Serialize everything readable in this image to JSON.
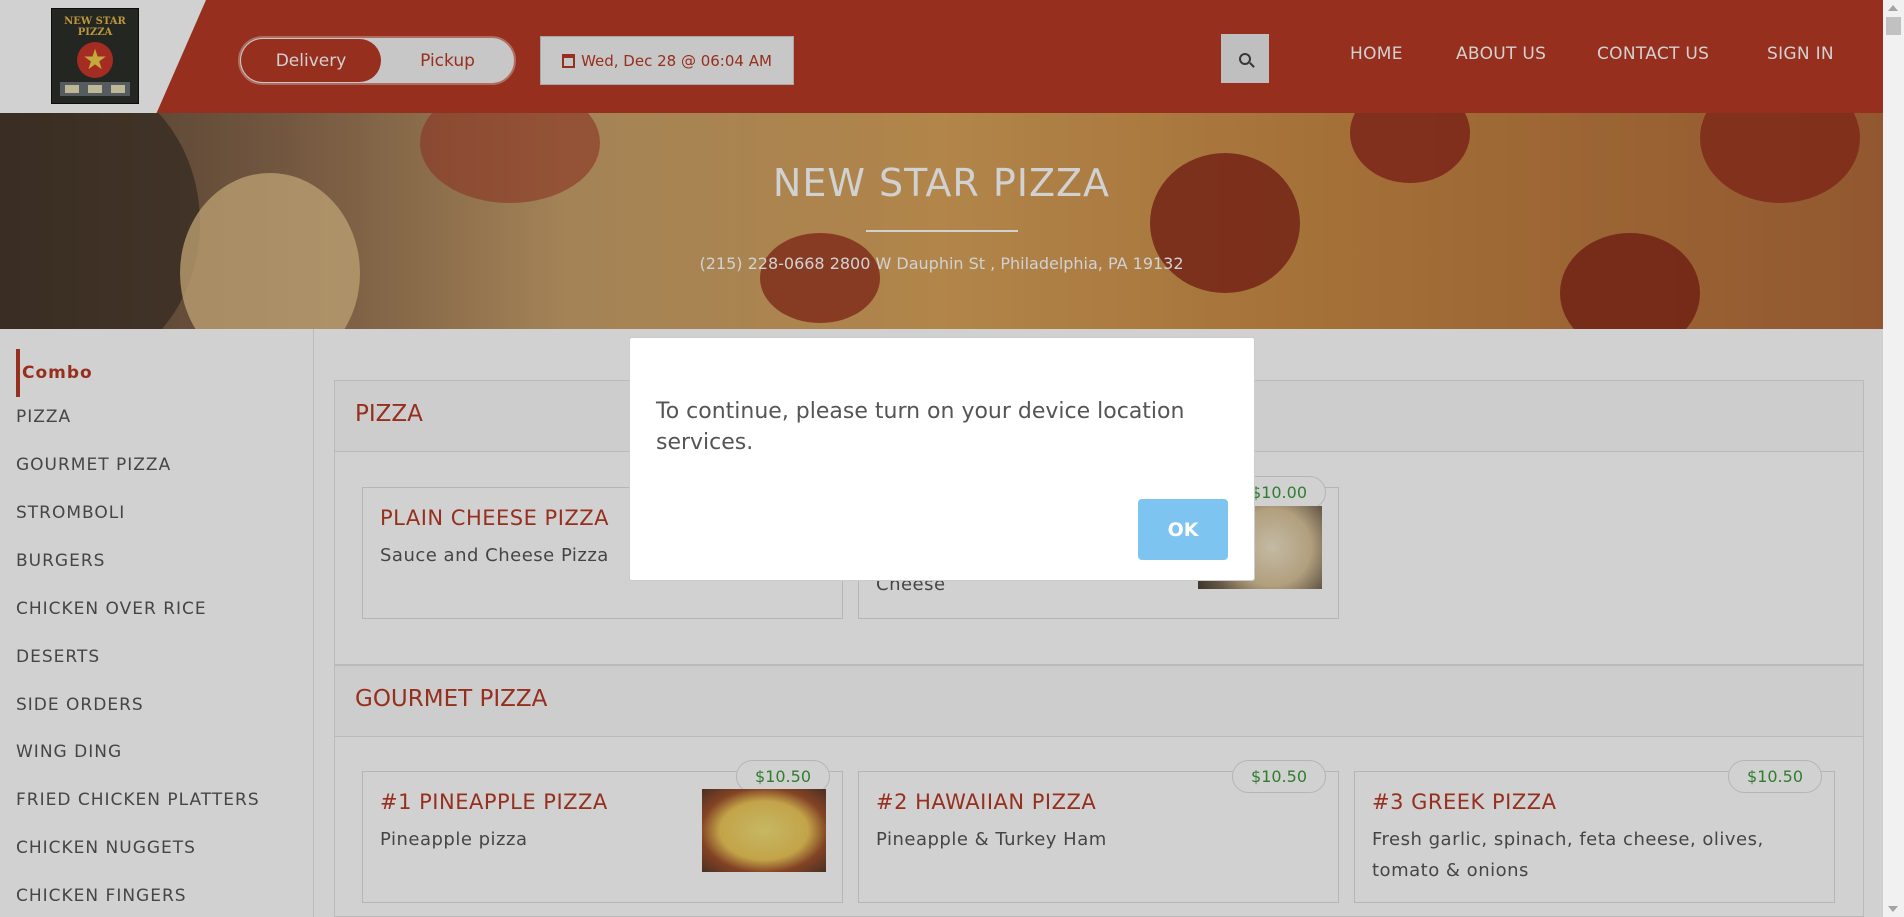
{
  "header": {
    "logo_text_top": "NEW STAR PIZZA",
    "logo_text_bottom": "",
    "order_type": {
      "active": "Delivery",
      "inactive": "Pickup"
    },
    "date_time": "Wed, Dec 28 @ 06:04 AM",
    "nav": [
      "HOME",
      "ABOUT US",
      "CONTACT US",
      "SIGN IN"
    ]
  },
  "hero": {
    "title": "NEW STAR PIZZA",
    "contact": "(215) 228-0668   2800 W Dauphin St , Philadelphia, PA 19132"
  },
  "sidebar": {
    "items": [
      "Combo",
      "PIZZA",
      "GOURMET PIZZA",
      "STROMBOLI",
      "BURGERS",
      "CHICKEN OVER RICE",
      "DESERTS",
      "SIDE ORDERS",
      "WING DING",
      "FRIED CHICKEN PLATTERS",
      "CHICKEN NUGGETS",
      "CHICKEN FINGERS"
    ]
  },
  "sections": [
    {
      "title": "PIZZA",
      "items": [
        {
          "name": "PLAIN CHEESE PIZZA",
          "desc": "Sauce and Cheese Pizza",
          "price": ""
        },
        {
          "name": "",
          "desc": "Cheese",
          "price": "$10.00"
        }
      ]
    },
    {
      "title": "GOURMET PIZZA",
      "items": [
        {
          "name": "#1 PINEAPPLE PIZZA",
          "desc": "Pineapple pizza",
          "price": "$10.50"
        },
        {
          "name": "#2 HAWAIIAN PIZZA",
          "desc": "Pineapple & Turkey Ham",
          "price": "$10.50"
        },
        {
          "name": "#3 GREEK PIZZA",
          "desc": "Fresh garlic, spinach, feta cheese, olives, tomato & onions",
          "price": "$10.50"
        }
      ]
    }
  ],
  "modal": {
    "message": "To continue, please turn on your device location services.",
    "ok_label": "OK"
  },
  "colors": {
    "brand": "#b83a24",
    "ok_button": "#7ec4f0",
    "price": "#3a9a3a"
  },
  "icons": [
    "calendar-icon",
    "search-icon"
  ]
}
